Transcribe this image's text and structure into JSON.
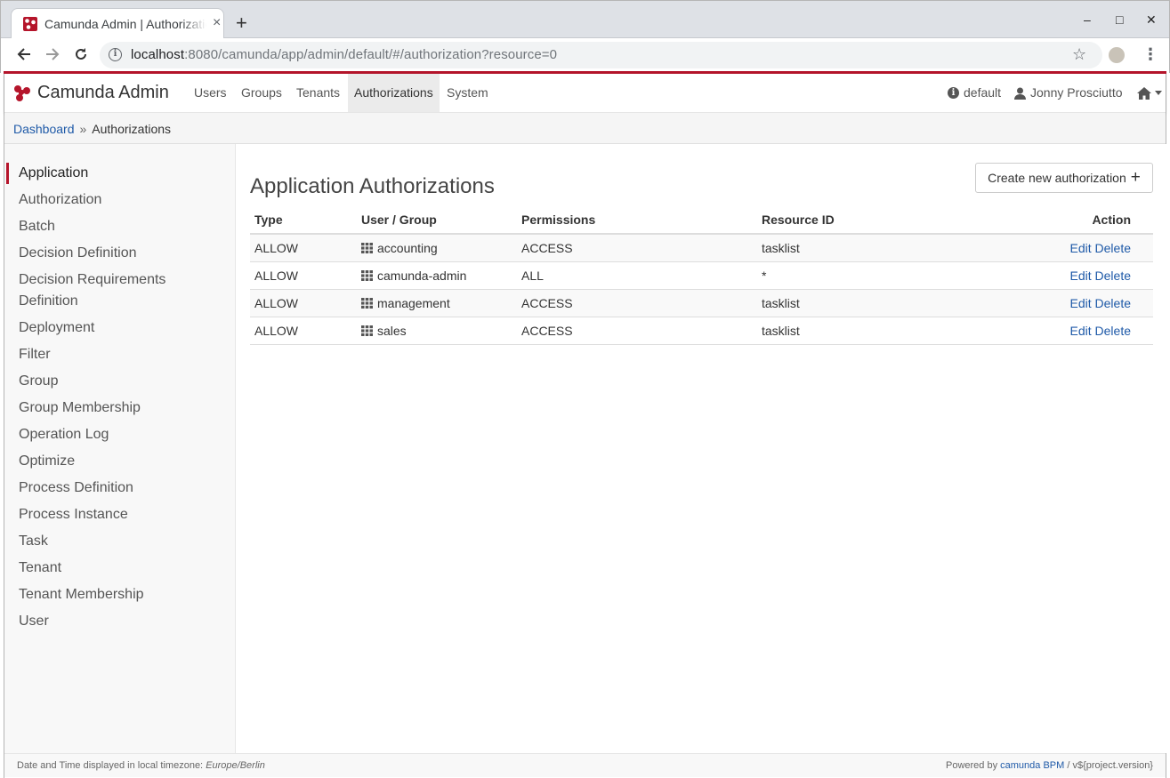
{
  "browser": {
    "tab_title": "Camunda Admin | Authorizations",
    "tab_close": "×",
    "new_tab": "+",
    "minimize": "–",
    "maximize": "□",
    "close": "✕",
    "url_host": "localhost",
    "url_rest": ":8080/camunda/app/admin/default/#/authorization?resource=0"
  },
  "header": {
    "brand": "Camunda Admin",
    "nav": [
      "Users",
      "Groups",
      "Tenants",
      "Authorizations",
      "System"
    ],
    "active_nav": "Authorizations",
    "engine": "default",
    "user": "Jonny Prosciutto"
  },
  "breadcrumb": {
    "root": "Dashboard",
    "separator": "»",
    "current": "Authorizations"
  },
  "sidebar": {
    "active": "Application",
    "items": [
      "Application",
      "Authorization",
      "Batch",
      "Decision Definition",
      "Decision Requirements Definition",
      "Deployment",
      "Filter",
      "Group",
      "Group Membership",
      "Operation Log",
      "Optimize",
      "Process Definition",
      "Process Instance",
      "Task",
      "Tenant",
      "Tenant Membership",
      "User"
    ]
  },
  "main": {
    "title": "Application Authorizations",
    "create_button": "Create new authorization",
    "create_icon": "+",
    "columns": [
      "Type",
      "User / Group",
      "Permissions",
      "Resource ID",
      "Action"
    ],
    "rows": [
      {
        "type": "ALLOW",
        "group": "accounting",
        "permissions": "ACCESS",
        "resource_id": "tasklist",
        "edit": "Edit",
        "delete": "Delete"
      },
      {
        "type": "ALLOW",
        "group": "camunda-admin",
        "permissions": "ALL",
        "resource_id": "*",
        "edit": "Edit",
        "delete": "Delete"
      },
      {
        "type": "ALLOW",
        "group": "management",
        "permissions": "ACCESS",
        "resource_id": "tasklist",
        "edit": "Edit",
        "delete": "Delete"
      },
      {
        "type": "ALLOW",
        "group": "sales",
        "permissions": "ACCESS",
        "resource_id": "tasklist",
        "edit": "Edit",
        "delete": "Delete"
      }
    ]
  },
  "footer": {
    "timezone_label": "Date and Time displayed in local timezone:",
    "timezone": "Europe/Berlin",
    "powered_by": "Powered by",
    "product": "camunda BPM",
    "version": "/ v${project.version}"
  },
  "colors": {
    "accent": "#b5152b",
    "link": "#1f5aa8"
  }
}
